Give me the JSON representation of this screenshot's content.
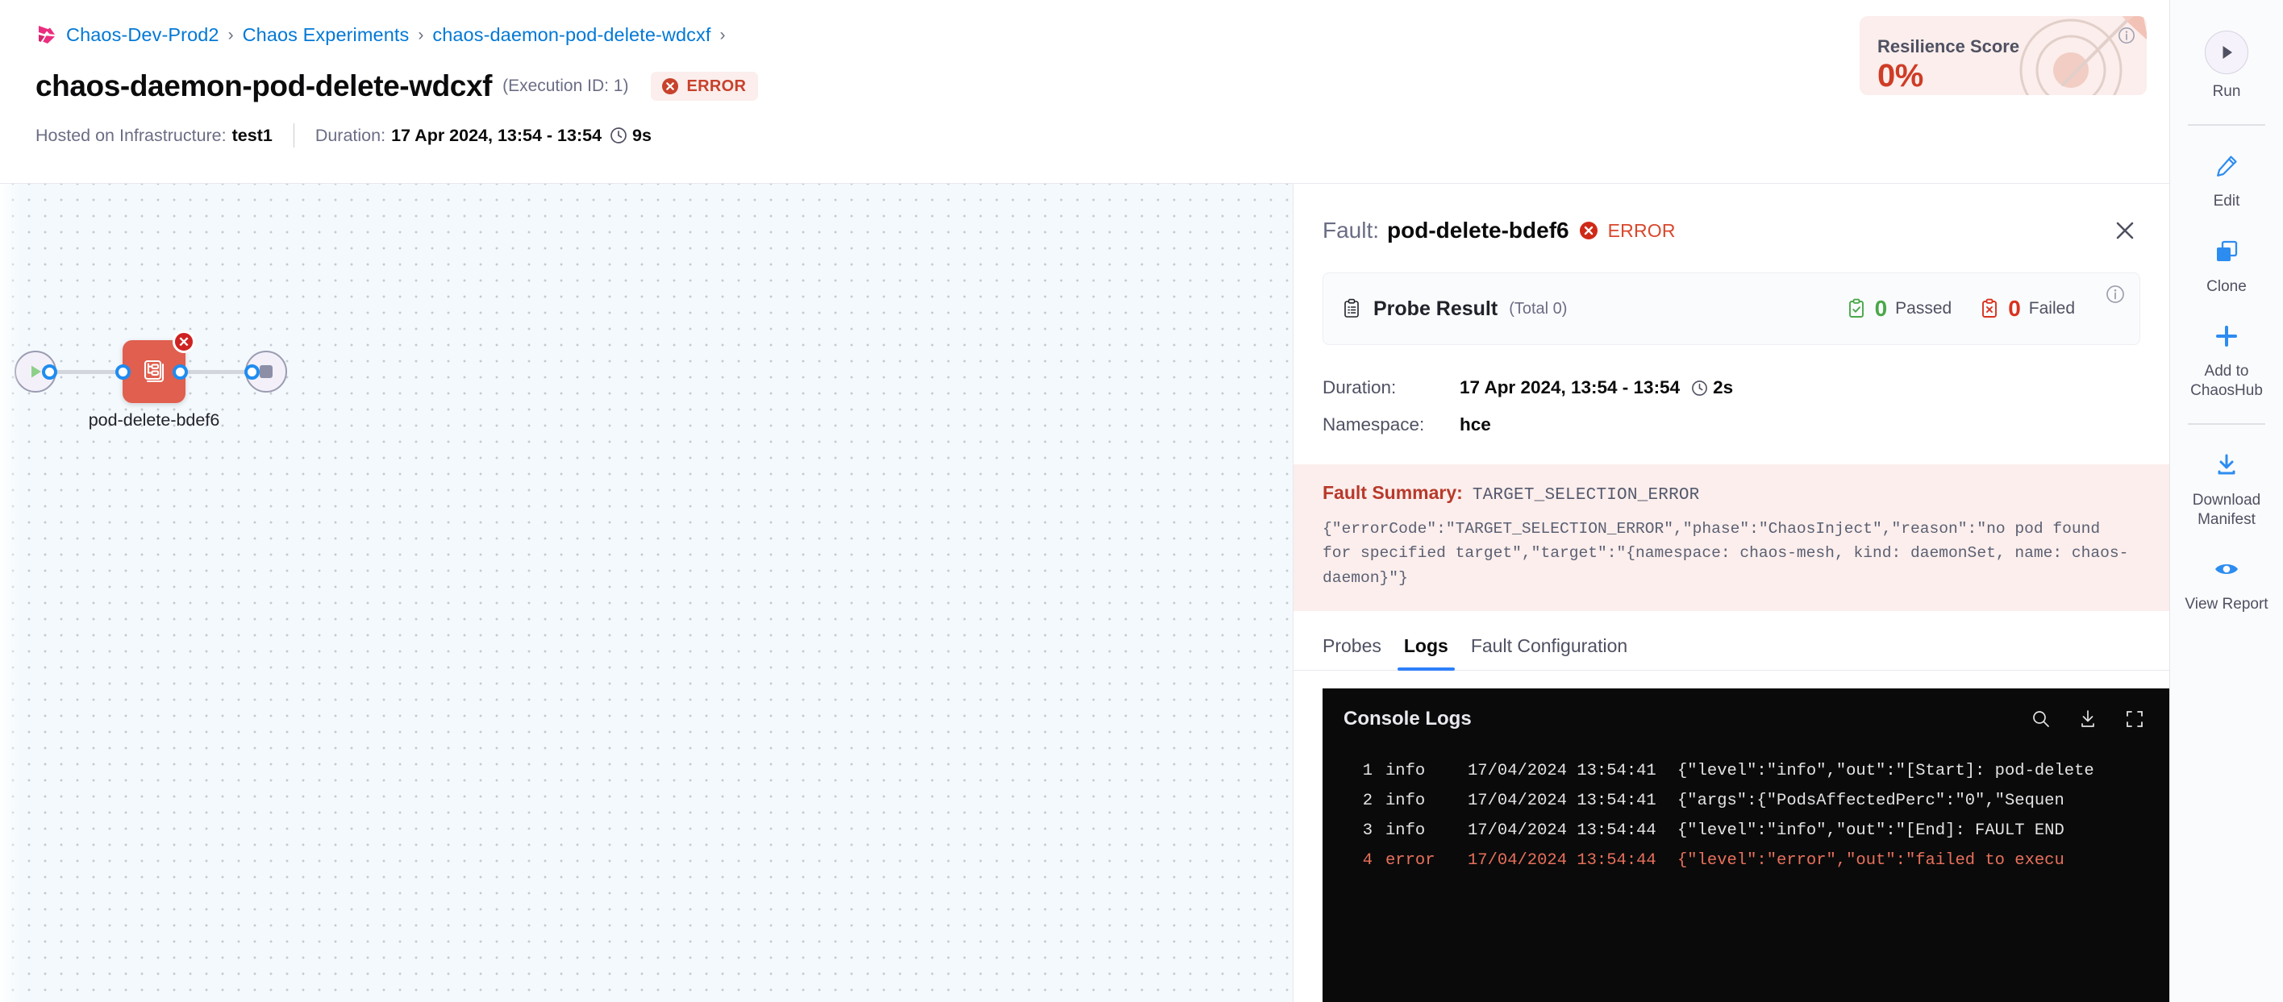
{
  "breadcrumb": {
    "logo_icon": "harness-logo-icon",
    "items": [
      "Chaos-Dev-Prod2",
      "Chaos Experiments",
      "chaos-daemon-pod-delete-wdcxf"
    ],
    "separator": "›"
  },
  "header": {
    "title": "chaos-daemon-pod-delete-wdcxf",
    "execution_id": "(Execution ID: 1)",
    "status": "ERROR",
    "status_icon": "error-circle-icon",
    "infrastructure_label": "Hosted on Infrastructure:",
    "infrastructure_value": "test1",
    "duration_label": "Duration:",
    "duration_value": "17 Apr 2024, 13:54 - 13:54",
    "duration_elapsed": "9s",
    "clock_icon": "clock-icon"
  },
  "resilience_card": {
    "title": "Resilience Score",
    "value": "0%",
    "info_icon": "info-icon",
    "art_icon": "target-arrow-icon",
    "bg_color": "#fbeeec",
    "value_color": "#cf3c26"
  },
  "graph": {
    "start_node_icon": "play-icon",
    "end_node_icon": "stop-square-icon",
    "fault_node_icon": "pod-delete-icon",
    "fault_node_label": "pod-delete-bdef6",
    "fault_node_badge_icon": "error-x-icon",
    "fault_node_color": "#e05f4e",
    "port_icon": "connector-port-icon"
  },
  "panel": {
    "title_prefix": "Fault:",
    "title_name": "pod-delete-bdef6",
    "status": "ERROR",
    "status_icon": "error-circle-icon",
    "close_icon": "close-icon",
    "probe": {
      "icon": "clipboard-icon",
      "title": "Probe Result",
      "total": "(Total 0)",
      "passed_count": "0",
      "passed_label": "Passed",
      "passed_icon": "clipboard-check-icon",
      "failed_count": "0",
      "failed_label": "Failed",
      "failed_icon": "clipboard-x-icon",
      "info_icon": "info-icon"
    },
    "details": [
      {
        "key": "Duration:",
        "value": "17 Apr 2024, 13:54 - 13:54",
        "elapsed": "2s",
        "clock_icon": "clock-icon"
      },
      {
        "key": "Namespace:",
        "value": "hce"
      }
    ],
    "fault_summary": {
      "label": "Fault Summary:",
      "code": "TARGET_SELECTION_ERROR",
      "body": "{\"errorCode\":\"TARGET_SELECTION_ERROR\",\"phase\":\"ChaosInject\",\"reason\":\"no pod found for specified target\",\"target\":\"{namespace: chaos-mesh, kind: daemonSet, name: chaos-daemon}\"}"
    },
    "tabs": [
      {
        "label": "Probes",
        "active": false
      },
      {
        "label": "Logs",
        "active": true
      },
      {
        "label": "Fault Configuration",
        "active": false
      }
    ],
    "console": {
      "title": "Console Logs",
      "search_icon": "search-icon",
      "download_icon": "download-icon",
      "fullscreen_icon": "fullscreen-icon",
      "lines": [
        {
          "no": "1",
          "level": "info",
          "ts": "17/04/2024 13:54:41",
          "msg": "{\"level\":\"info\",\"out\":\"[Start]: pod-delete"
        },
        {
          "no": "2",
          "level": "info",
          "ts": "17/04/2024 13:54:41",
          "msg": "{\"args\":{\"PodsAffectedPerc\":\"0\",\"Sequen"
        },
        {
          "no": "3",
          "level": "info",
          "ts": "17/04/2024 13:54:44",
          "msg": "{\"level\":\"info\",\"out\":\"[End]: FAULT END"
        },
        {
          "no": "4",
          "level": "error",
          "ts": "17/04/2024 13:54:44",
          "msg": "{\"level\":\"error\",\"out\":\"failed to execu"
        }
      ]
    }
  },
  "rail": {
    "items": [
      {
        "label": "Run",
        "icon": "play-icon",
        "style": "run"
      },
      {
        "label": "Edit",
        "icon": "pencil-icon",
        "style": "normal"
      },
      {
        "label": "Clone",
        "icon": "clone-icon",
        "style": "normal"
      },
      {
        "label": "Add to ChaosHub",
        "icon": "plus-icon",
        "style": "normal"
      },
      {
        "label": "Download Manifest",
        "icon": "download-icon",
        "style": "normal"
      },
      {
        "label": "View Report",
        "icon": "eye-icon",
        "style": "normal"
      }
    ]
  }
}
